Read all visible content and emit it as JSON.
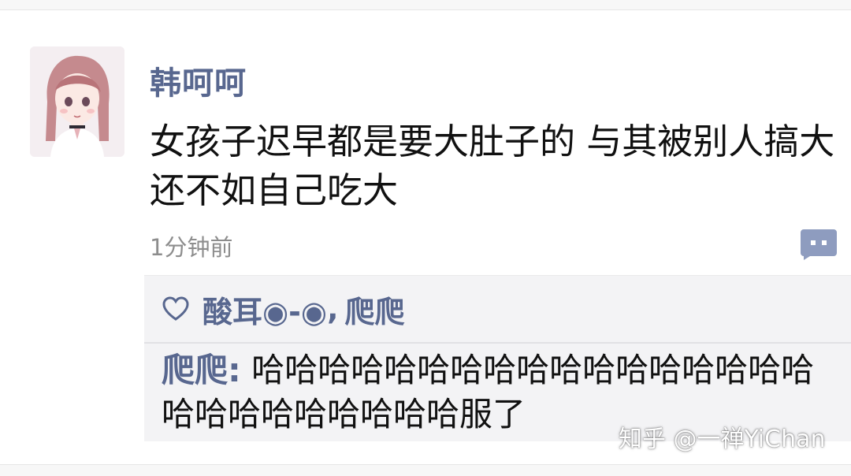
{
  "comment": {
    "username": "韩呵呵",
    "text": "女孩子迟早都是要大肚子的 与其被别人搞大还不如自己吃大",
    "timestamp": "1分钟前",
    "avatar_icon": "anime-girl-avatar",
    "comment_icon": "comment-bubble-icon"
  },
  "reply_section": {
    "likes": {
      "icon": "heart-icon",
      "users": [
        "酸耳◉-◉",
        "爬爬"
      ],
      "separator": ","
    },
    "reply": {
      "author": "爬爬",
      "colon": ":",
      "text": " 哈哈哈哈哈哈哈哈哈哈哈哈哈哈哈哈哈哈哈哈哈哈哈哈哈哈服了"
    }
  },
  "watermark": "知乎 @一禅YiChan",
  "colors": {
    "username": "#58678f",
    "text": "#111111",
    "timestamp": "#8d8d8d",
    "reply_bg": "#f3f3f5",
    "icon": "#8e9cbf"
  }
}
